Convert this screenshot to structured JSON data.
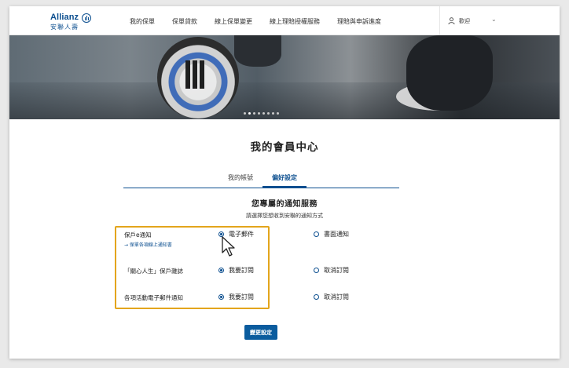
{
  "header": {
    "brand_en": "Allianz",
    "brand_zh": "安聯人壽",
    "nav": [
      "我的保單",
      "保單貸款",
      "線上保單變更",
      "線上理賠授權服務",
      "理賠與申訴進度"
    ],
    "user_greeting": "歡迎",
    "user_chevron": "⌄"
  },
  "hero": {
    "slide_count": 8,
    "active_slide": 1
  },
  "page": {
    "title": "我的會員中心",
    "tabs": [
      "我的帳號",
      "偏好設定"
    ],
    "active_tab": 1,
    "section_title": "您專屬的通知服務",
    "section_subtitle": "請選擇您想收到安聯的通知方式"
  },
  "settings": [
    {
      "label": "保戶e通知",
      "link": "→ 保單各項線上通知書",
      "options": [
        {
          "label": "電子郵件",
          "selected": true
        },
        {
          "label": "書面通知",
          "selected": false
        }
      ]
    },
    {
      "label": "「關心人生」保戶雜誌",
      "options": [
        {
          "label": "我要訂閱",
          "selected": true
        },
        {
          "label": "取消訂閱",
          "selected": false
        }
      ]
    },
    {
      "label": "各項活動電子郵件通知",
      "options": [
        {
          "label": "我要訂閱",
          "selected": true
        },
        {
          "label": "取消訂閱",
          "selected": false
        }
      ]
    }
  ],
  "actions": {
    "save_label": "變更設定"
  },
  "colors": {
    "brand_blue": "#0b4e8f",
    "button_blue": "#0b5c9e",
    "highlight": "#e3a51c"
  }
}
